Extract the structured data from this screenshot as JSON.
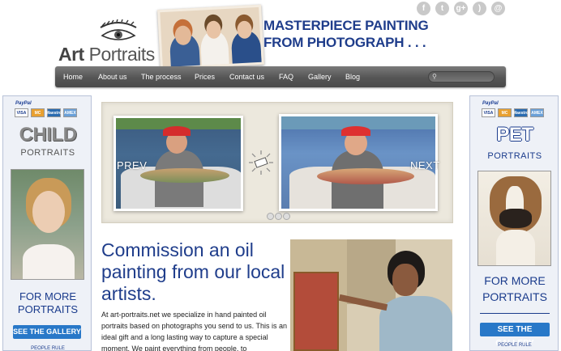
{
  "logo": {
    "first": "Art",
    "second": "Portraits"
  },
  "headline": {
    "line1": "MASTERPIECE PAINTING",
    "line2": "FROM PHOTOGRAPH . . ."
  },
  "social": [
    {
      "icon": "facebook-icon",
      "glyph": "f"
    },
    {
      "icon": "twitter-icon",
      "glyph": "t"
    },
    {
      "icon": "google-plus-icon",
      "glyph": "g+"
    },
    {
      "icon": "rss-icon",
      "glyph": ")"
    },
    {
      "icon": "email-icon",
      "glyph": "@"
    }
  ],
  "nav": {
    "items": [
      "Home",
      "About us",
      "The process",
      "Prices",
      "Contact us",
      "FAQ",
      "Gallery",
      "Blog"
    ]
  },
  "left_panel": {
    "paypal": "PayPal",
    "title": "CHILD",
    "subtitle": "PORTRAITS",
    "more_line1": "FOR MORE",
    "more_line2": "PORTRAITS",
    "button": "SEE THE GALLERY",
    "footer": "PEOPLE RULE"
  },
  "right_panel": {
    "paypal": "PayPal",
    "title": "PET",
    "subtitle": "PORTRAITS",
    "more_line1": "FOR MORE",
    "more_line2": "PORTRAITS",
    "button": "SEE THE GALLERY",
    "footer": "PEOPLE RULE"
  },
  "cards": [
    "VISA",
    "MC",
    "Maestro",
    "AMEX"
  ],
  "slider": {
    "prev": "PREV",
    "next": "NEXT",
    "pages": 3,
    "active": 1
  },
  "content": {
    "heading": "Commission an oil painting from our local artists.",
    "body": "At art-portraits.net we specialize in hand painted oil portraits based on photographs you send to us. This is an ideal gift and a long lasting way to capture a special moment. We paint everything from people, to"
  },
  "colors": {
    "brand_blue": "#1f3d8b",
    "button_blue": "#2878c8",
    "nav_gray": "#555555"
  }
}
